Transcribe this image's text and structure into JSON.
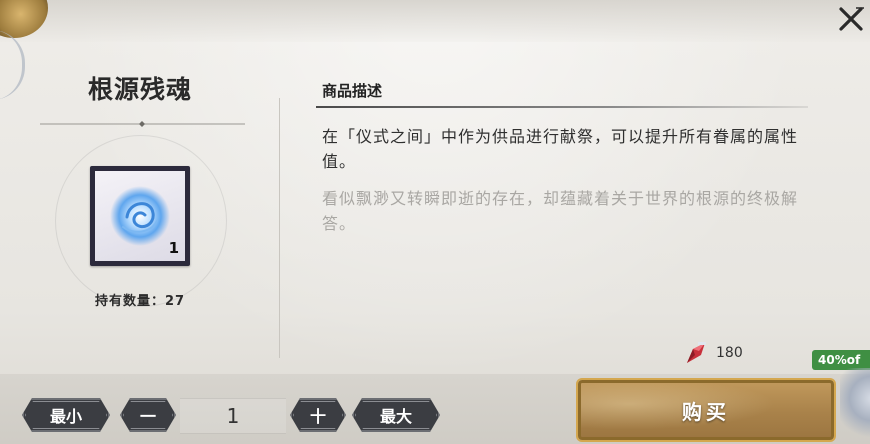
{
  "item": {
    "name": "根源残魂",
    "count_badge": "1",
    "owned_text": "持有数量：27"
  },
  "description": {
    "header": "商品描述",
    "primary": "在「仪式之间」中作为供品进行献祭，可以提升所有眷属的属性值。",
    "secondary": "看似飘渺又转瞬即逝的存在，却蕴藏着关于世界的根源的终极解答。"
  },
  "price": {
    "value": "180",
    "currency_icon": "red-crystal-icon"
  },
  "discount_badge": "40%of",
  "quantity": {
    "min_label": "最小",
    "minus_label": "一",
    "value": "1",
    "plus_label": "十",
    "max_label": "最大"
  },
  "buy": {
    "label": "购买"
  },
  "colors": {
    "accent_green": "#3f8f43",
    "buy_gold": "#b58c52",
    "dark_button": "#3b3d42"
  }
}
